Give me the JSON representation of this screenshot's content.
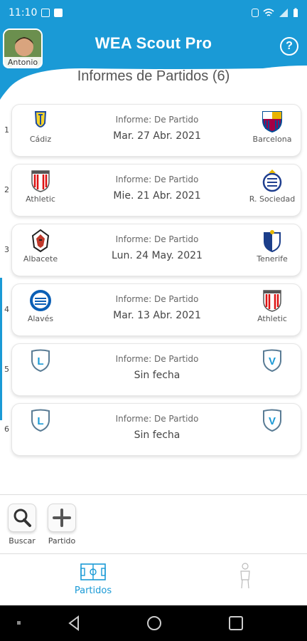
{
  "status_bar": {
    "time": "11:10"
  },
  "header": {
    "app_title": "WEA Scout Pro",
    "user_name": "Antonio",
    "help_label": "?"
  },
  "page": {
    "title": "Informes de Partidos (6)"
  },
  "reports": [
    {
      "index": "1",
      "home": "Cádiz",
      "away": "Barcelona",
      "type": "Informe: De Partido",
      "date": "Mar. 27 Abr. 2021",
      "home_crest": "cadiz-crest",
      "away_crest": "barcelona-crest"
    },
    {
      "index": "2",
      "home": "Athletic",
      "away": "R. Sociedad",
      "type": "Informe: De Partido",
      "date": "Mie. 21 Abr. 2021",
      "home_crest": "athletic-crest",
      "away_crest": "real-sociedad-crest"
    },
    {
      "index": "3",
      "home": "Albacete",
      "away": "Tenerife",
      "type": "Informe: De Partido",
      "date": "Lun. 24 May. 2021",
      "home_crest": "albacete-crest",
      "away_crest": "tenerife-crest"
    },
    {
      "index": "4",
      "home": "Alavés",
      "away": "Athletic",
      "type": "Informe: De Partido",
      "date": "Mar. 13 Abr. 2021",
      "home_crest": "alaves-crest",
      "away_crest": "athletic-crest"
    },
    {
      "index": "5",
      "home": "",
      "away": "",
      "type": "Informe: De Partido",
      "date": "Sin fecha",
      "home_crest": "local-badge",
      "away_crest": "visitor-badge"
    },
    {
      "index": "6",
      "home": "",
      "away": "",
      "type": "Informe: De Partido",
      "date": "Sin fecha",
      "home_crest": "local-badge",
      "away_crest": "visitor-badge"
    }
  ],
  "badges": {
    "local": "L",
    "visitor": "V"
  },
  "toolbar": {
    "search_label": "Buscar",
    "add_label": "Partido"
  },
  "bottom_nav": {
    "matches_label": "Partidos"
  },
  "colors": {
    "primary": "#1a9ad6"
  }
}
